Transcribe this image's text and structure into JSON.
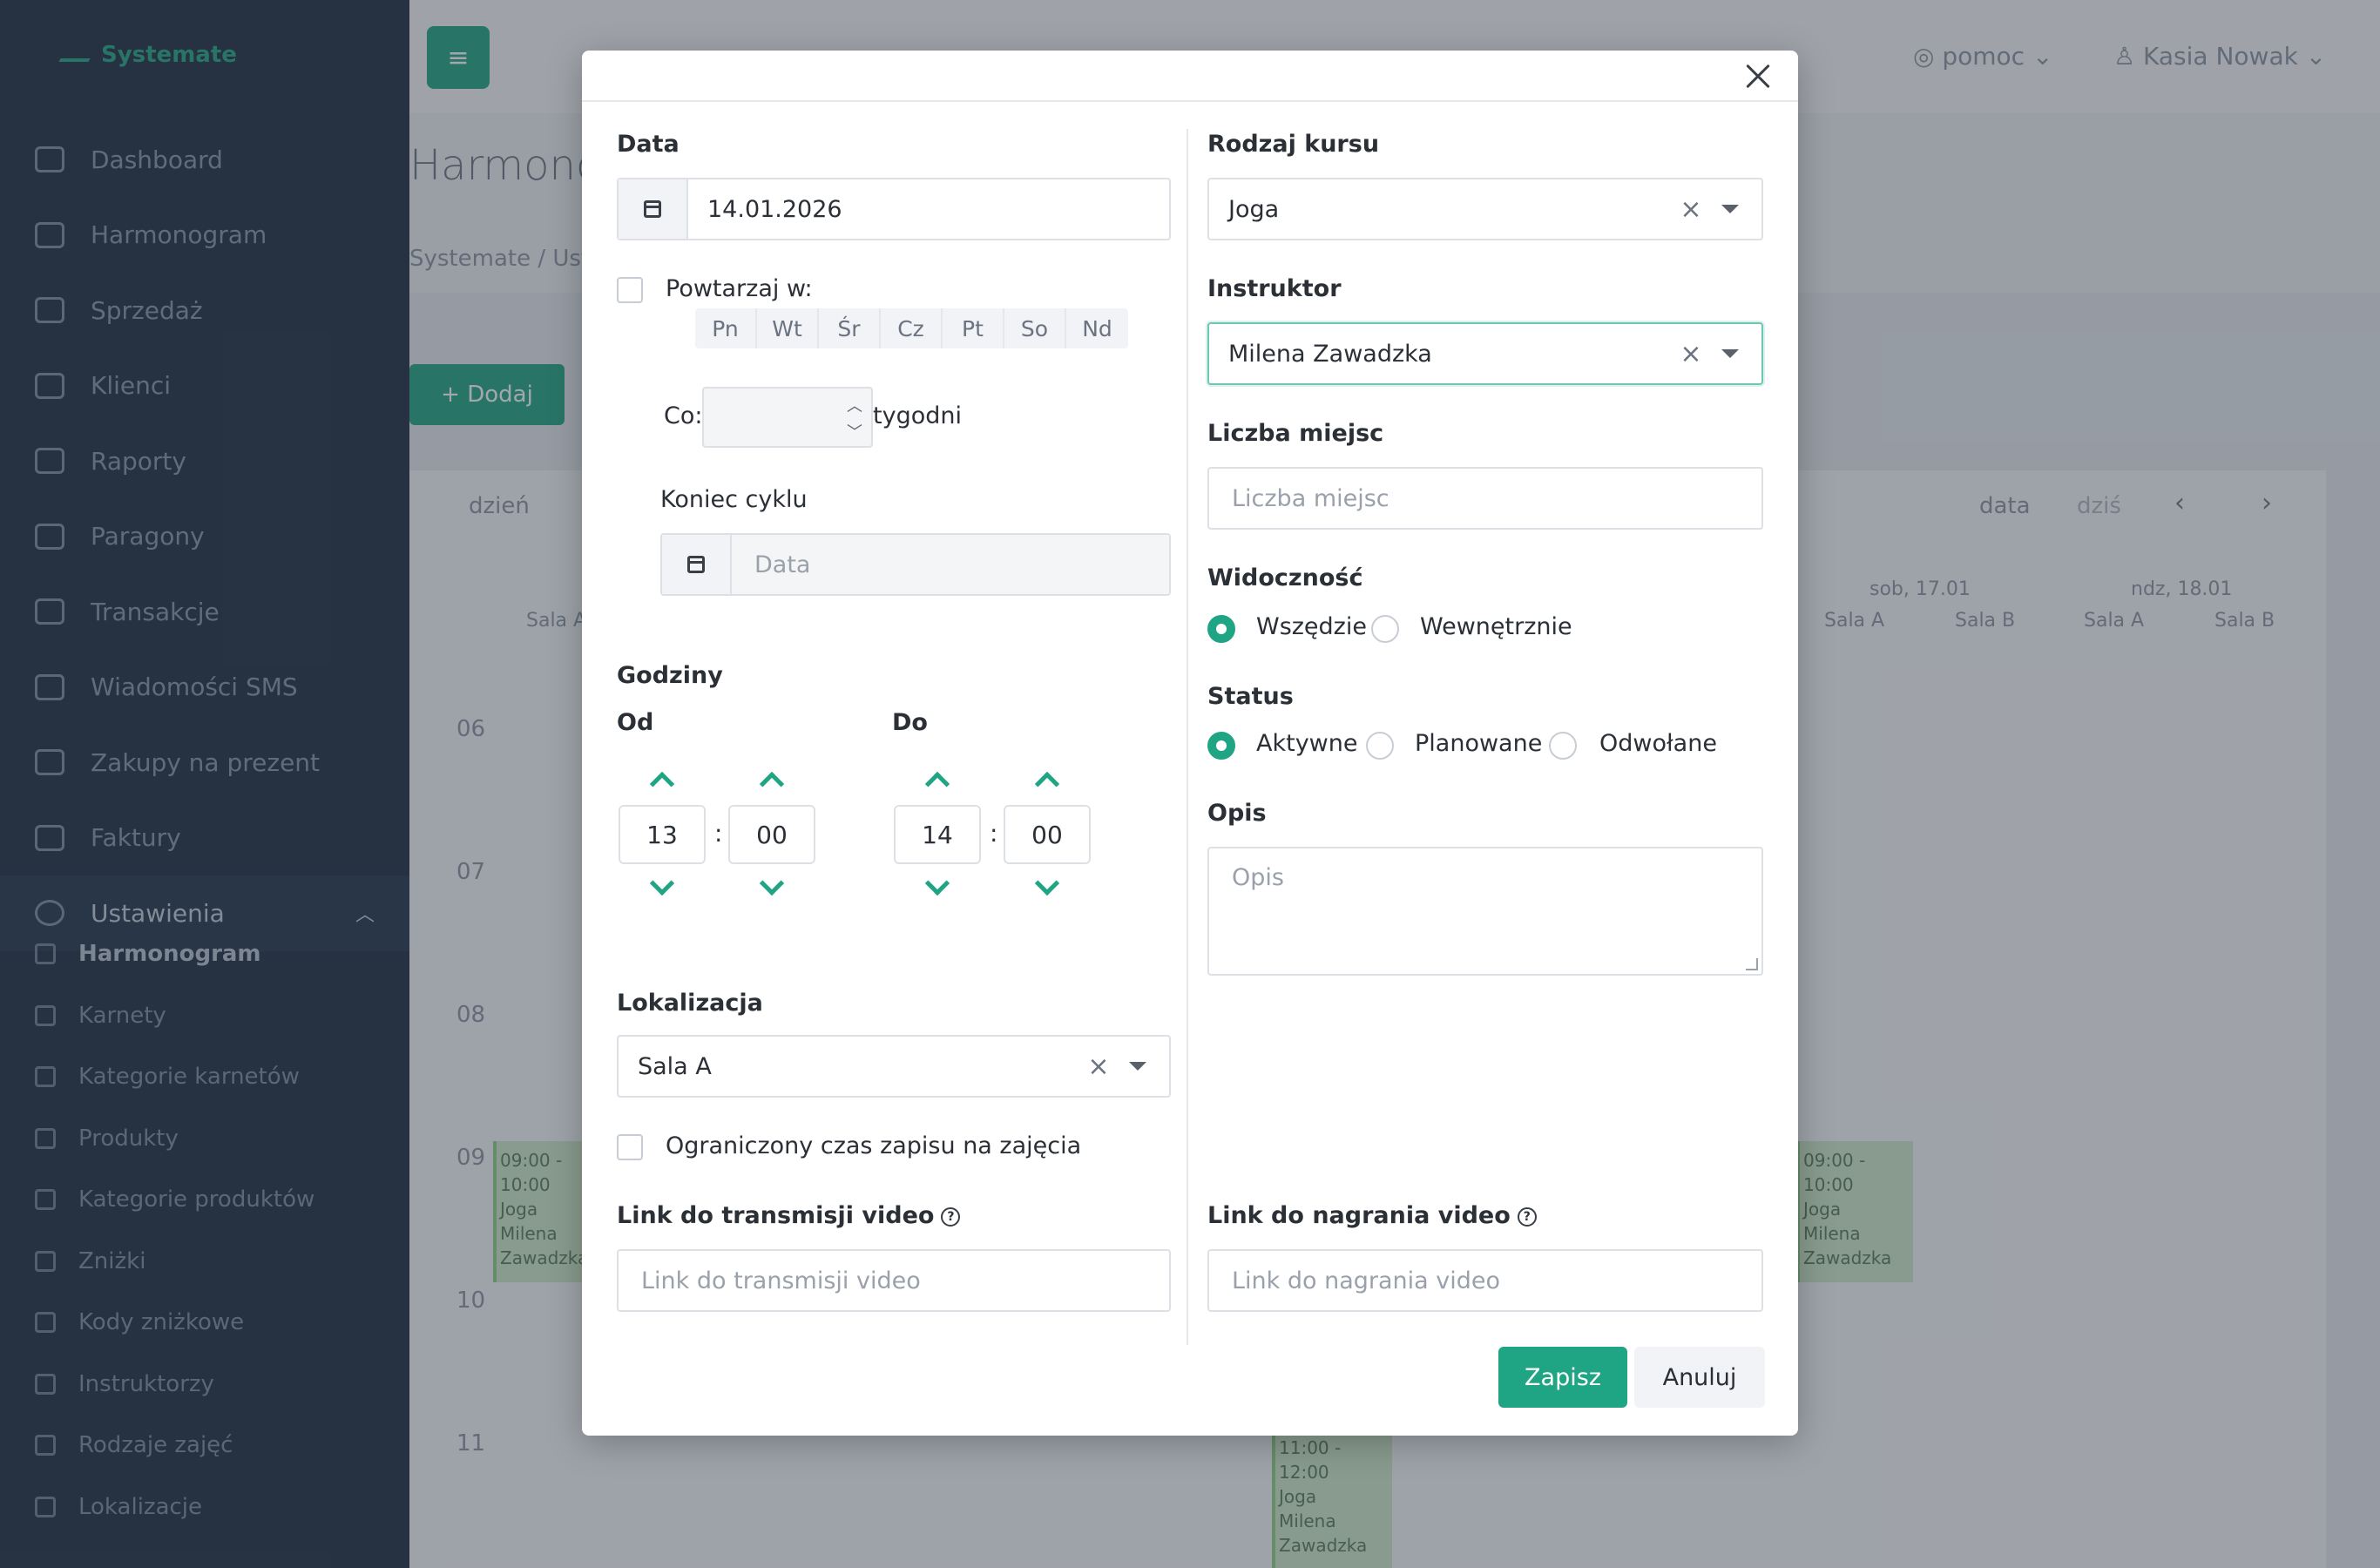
{
  "app": {
    "logo": "Systemate",
    "topbar": {
      "help": "pomoc",
      "user": "Kasia Nowak"
    },
    "page_title": "Harmonogram",
    "breadcrumb": "Systemate / Ustawienia",
    "add_button": "+ Dodaj",
    "sidebar": {
      "items": [
        {
          "label": "Dashboard",
          "icon": "home-icon"
        },
        {
          "label": "Harmonogram",
          "icon": "calendar-icon"
        },
        {
          "label": "Sprzedaż",
          "icon": "basket-icon"
        },
        {
          "label": "Klienci",
          "icon": "clients-icon"
        },
        {
          "label": "Raporty",
          "icon": "chart-icon"
        },
        {
          "label": "Paragony",
          "icon": "receipt-icon"
        },
        {
          "label": "Transakcje",
          "icon": "list-icon"
        },
        {
          "label": "Wiadomości SMS",
          "icon": "chat-icon"
        },
        {
          "label": "Zakupy na prezent",
          "icon": "gift-icon"
        },
        {
          "label": "Faktury",
          "icon": "document-icon"
        },
        {
          "label": "Ustawienia",
          "icon": "gear-icon"
        }
      ],
      "sub_items": [
        {
          "label": "Harmonogram"
        },
        {
          "label": "Karnety"
        },
        {
          "label": "Kategorie karnetów"
        },
        {
          "label": "Produkty"
        },
        {
          "label": "Kategorie produktów"
        },
        {
          "label": "Zniżki"
        },
        {
          "label": "Kody zniżkowe"
        },
        {
          "label": "Instruktorzy"
        },
        {
          "label": "Rodzaje zajęć"
        },
        {
          "label": "Lokalizacje"
        }
      ]
    },
    "calendar": {
      "view_day": "dzień",
      "nav_date": "data",
      "nav_today": "dziś",
      "prev": "‹",
      "next": "›",
      "col_heads": [
        {
          "day": "sob, 17.01",
          "rooms": [
            "Sala A",
            "Sala B"
          ]
        },
        {
          "day": "ndz, 18.01",
          "rooms": [
            "Sala A",
            "Sala B"
          ]
        }
      ],
      "left_room": "Sala A",
      "hours": [
        "06",
        "07",
        "08",
        "09",
        "10",
        "11"
      ],
      "events": [
        {
          "time": "09:00 - 10:00",
          "name": "Joga",
          "instructor": "Milena Zawadzka"
        },
        {
          "time": "09:00 - 10:00",
          "name": "Joga",
          "instructor": "Milena Zawadzka"
        },
        {
          "time": "11:00 - 12:00",
          "name": "Joga",
          "instructor": "Milena Zawadzka"
        }
      ]
    }
  },
  "modal": {
    "date_label": "Data",
    "date_value": "14.01.2026",
    "repeat_label": "Powtarzaj w:",
    "days": [
      "Pn",
      "Wt",
      "Śr",
      "Cz",
      "Pt",
      "So",
      "Nd"
    ],
    "every_label": "Co:",
    "weeks_label": "tygodni",
    "cycle_end_label": "Koniec cyklu",
    "cycle_end_placeholder": "Data",
    "hours_label": "Godziny",
    "from_label": "Od",
    "to_label": "Do",
    "from_hour": "13",
    "from_min": "00",
    "to_hour": "14",
    "to_min": "00",
    "location_label": "Lokalizacja",
    "location_value": "Sala A",
    "limited_label": "Ograniczony czas zapisu na zajęcia",
    "stream_label": "Link do transmisji video",
    "stream_placeholder": "Link do transmisji video",
    "course_label": "Rodzaj kursu",
    "course_value": "Joga",
    "instructor_label": "Instruktor",
    "instructor_value": "Milena Zawadzka",
    "seats_label": "Liczba miejsc",
    "seats_placeholder": "Liczba miejsc",
    "visibility_label": "Widoczność",
    "visibility_options": [
      "Wszędzie",
      "Wewnętrznie"
    ],
    "visibility_selected": "Wszędzie",
    "status_label": "Status",
    "status_options": [
      "Aktywne",
      "Planowane",
      "Odwołane"
    ],
    "status_selected": "Aktywne",
    "desc_label": "Opis",
    "desc_placeholder": "Opis",
    "recording_label": "Link do nagrania video",
    "recording_placeholder": "Link do nagrania video",
    "save": "Zapisz",
    "cancel": "Anuluj"
  },
  "colors": {
    "accent": "#1fa584",
    "overlay": "rgba(52,60,72,0.45)"
  }
}
